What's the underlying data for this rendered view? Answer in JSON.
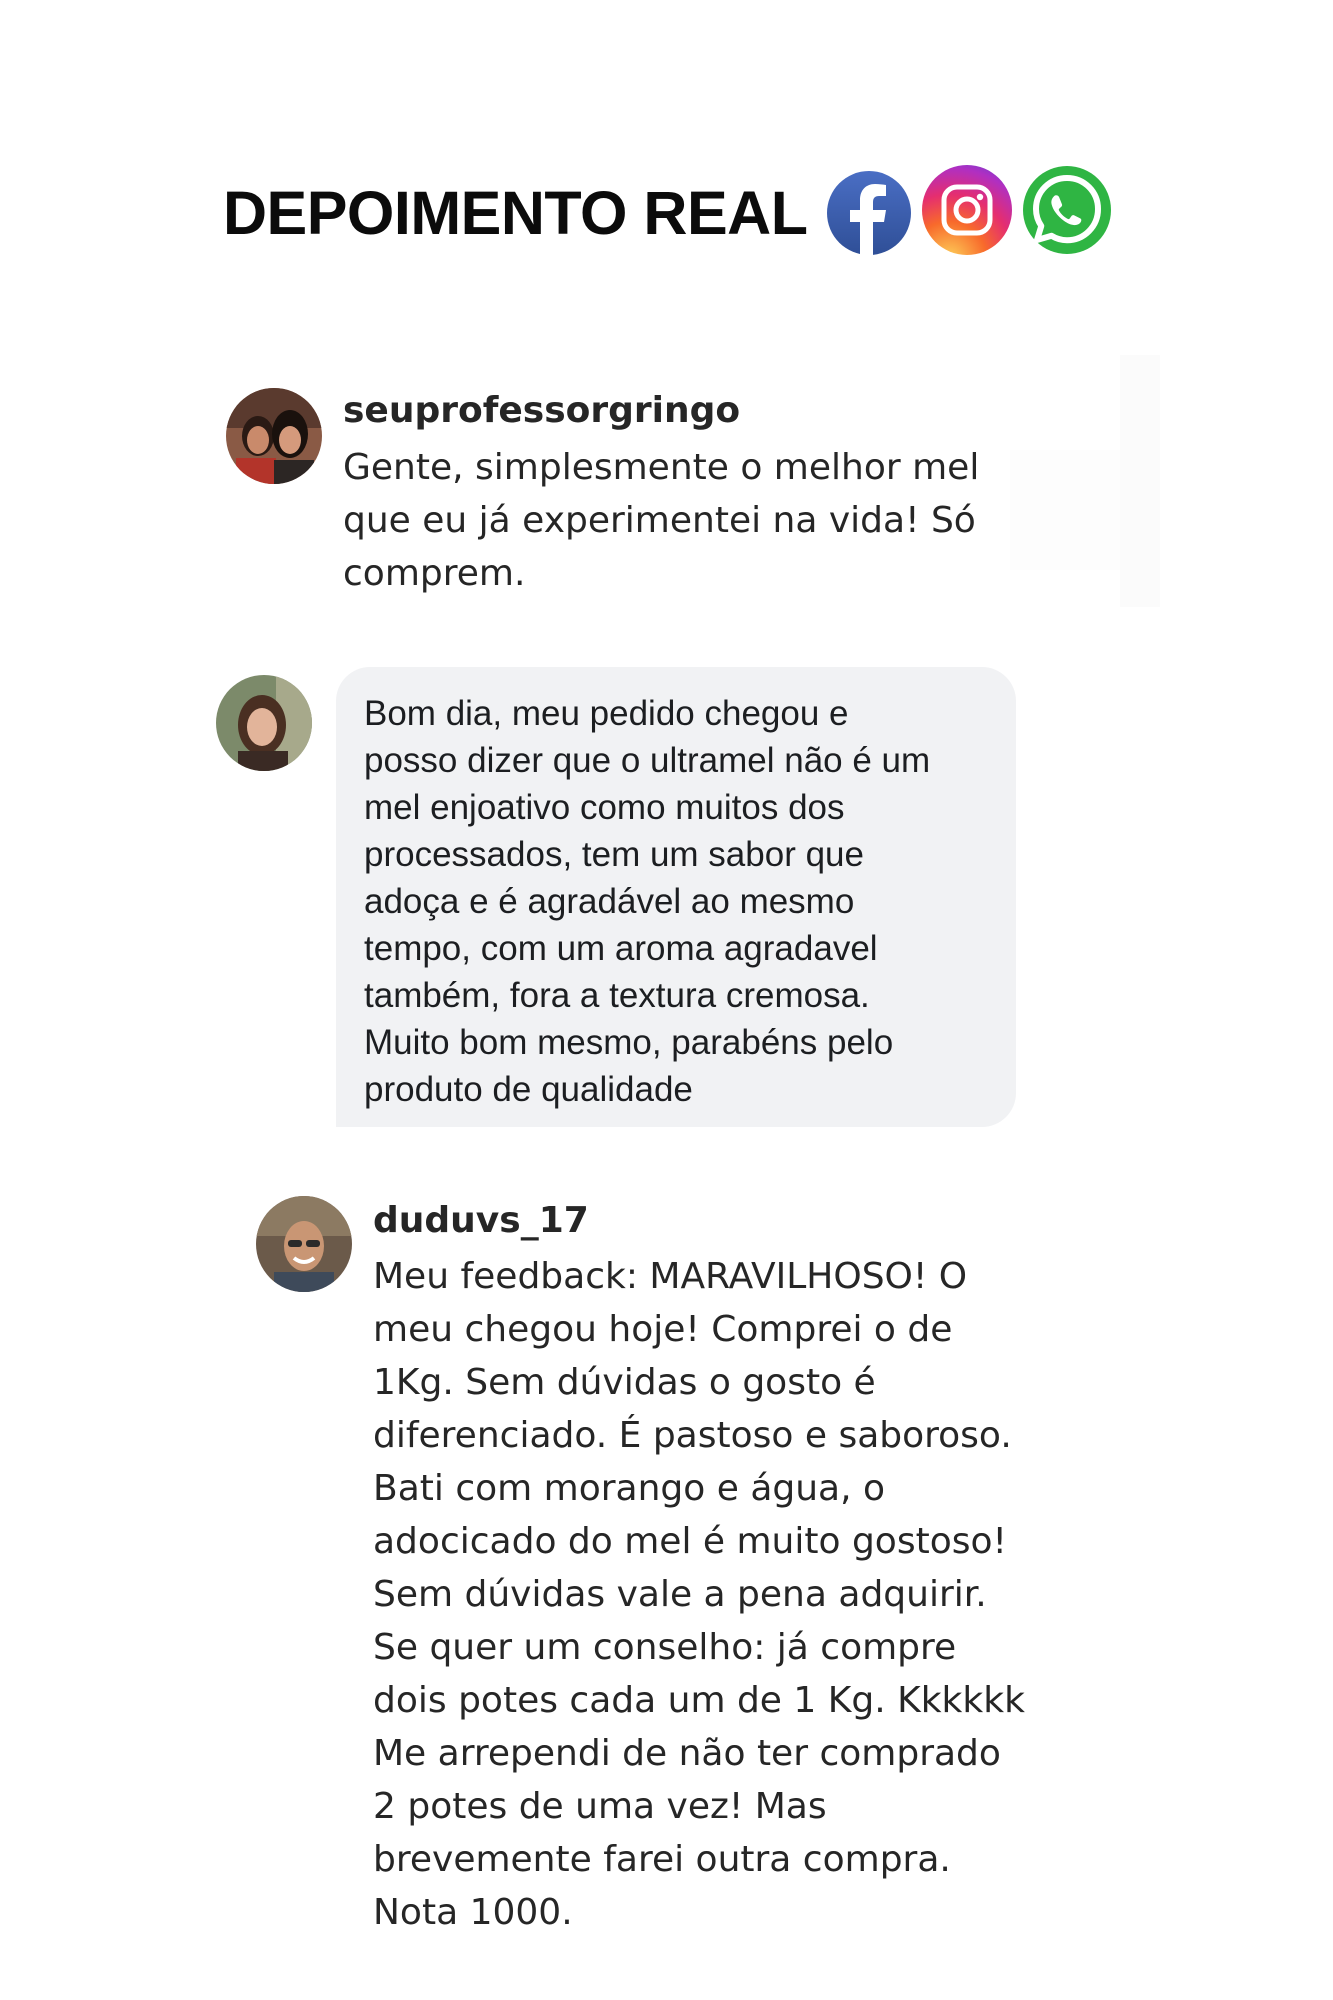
{
  "header": {
    "title": "DEPOIMENTO REAL",
    "icons": [
      "facebook-icon",
      "instagram-icon",
      "whatsapp-icon"
    ]
  },
  "comments": [
    {
      "username": "seuprofessorgringo",
      "text": "Gente, simplesmente o melhor mel\nque eu já experimentei na vida! Só\ncomprem."
    },
    {
      "username": "",
      "text": "Bom dia, meu pedido chegou e\nposso dizer que o ultramel não é um\nmel enjoativo como muitos  dos\nprocessados, tem um sabor que\nadoça e é agradável ao mesmo\ntempo, com um aroma agradavel\ntambém, fora a textura cremosa.\nMuito bom mesmo, parabéns pelo\nproduto de qualidade"
    },
    {
      "username": "duduvs_17",
      "text": "Meu feedback: MARAVILHOSO! O\nmeu chegou hoje! Comprei o de\n1Kg. Sem dúvidas o gosto é\ndiferenciado. É pastoso e saboroso.\nBati com morango e água, o\nadocicado do mel é muito gostoso!\nSem dúvidas vale a pena adquirir.\nSe quer um conselho: já compre\ndois potes cada um de 1 Kg. Kkkkkk\nMe arrependi de não ter comprado\n2 potes de uma vez! Mas\nbrevemente farei outra compra.\nNota 1000."
    }
  ],
  "colors": {
    "facebook": "#3b5998",
    "whatsapp": "#2fb543",
    "bubble": "#f1f2f4",
    "text": "#262626"
  }
}
